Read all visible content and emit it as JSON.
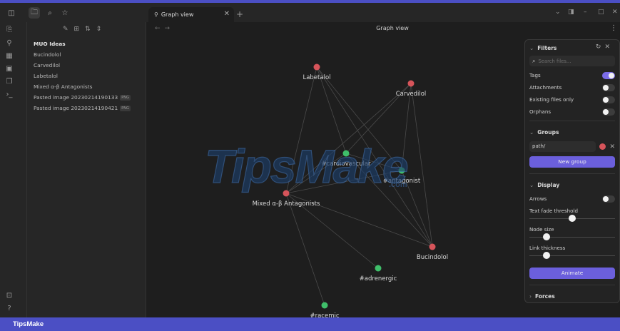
{
  "titlebar": {
    "tab_title": "Graph view",
    "tab_icon": "graph-icon",
    "win_controls": [
      "chevron-down-icon",
      "layout-icon",
      "minimize-icon",
      "maximize-icon",
      "close-icon"
    ]
  },
  "ribbon": {
    "icons": [
      "open-file-icon",
      "graph-icon",
      "canvas-icon",
      "calendar-icon",
      "copy-icon",
      "terminal-icon"
    ],
    "bottom_icons": [
      "vault-icon",
      "help-icon"
    ]
  },
  "sidebar": {
    "tools": [
      "new-note-icon",
      "new-folder-icon",
      "sort-icon",
      "collapse-icon"
    ],
    "folder": "MUO Ideas",
    "files": [
      {
        "name": "Bucindolol",
        "badge": ""
      },
      {
        "name": "Carvedilol",
        "badge": ""
      },
      {
        "name": "Labetalol",
        "badge": ""
      },
      {
        "name": "Mixed α-β Antagonists",
        "badge": ""
      },
      {
        "name": "Pasted image 20230214190133",
        "badge": "PNG"
      },
      {
        "name": "Pasted image 20230214190421",
        "badge": "PNG"
      }
    ]
  },
  "main": {
    "title": "Graph view"
  },
  "graph": {
    "nodes": [
      {
        "label": "Labetalol",
        "kind": "note",
        "color": "#d6545a"
      },
      {
        "label": "Carvedilol",
        "kind": "note",
        "color": "#d6545a"
      },
      {
        "label": "#cardiovascular",
        "kind": "tag",
        "color": "#3fbf6a"
      },
      {
        "label": "#antagonist",
        "kind": "tag",
        "color": "#3fbf6a"
      },
      {
        "label": "Mixed α-β Antagonists",
        "kind": "note",
        "color": "#d6545a"
      },
      {
        "label": "Bucindolol",
        "kind": "note",
        "color": "#d6545a"
      },
      {
        "label": "#adrenergic",
        "kind": "tag",
        "color": "#3fbf6a"
      },
      {
        "label": "#racemic",
        "kind": "tag",
        "color": "#3fbf6a"
      }
    ]
  },
  "watermark": {
    "text": "TipsMake",
    "suffix": ".com"
  },
  "filters": {
    "title": "Filters",
    "search_placeholder": "Search files...",
    "toggles": [
      {
        "label": "Tags",
        "on": true
      },
      {
        "label": "Attachments",
        "on": false
      },
      {
        "label": "Existing files only",
        "on": false
      },
      {
        "label": "Orphans",
        "on": false
      }
    ],
    "groups_title": "Groups",
    "group_query": "path/",
    "group_color": "#d6545a",
    "new_group_label": "New group",
    "display_title": "Display",
    "arrows_label": "Arrows",
    "arrows_on": false,
    "sliders": [
      {
        "label": "Text fade threshold",
        "value": 0.5
      },
      {
        "label": "Node size",
        "value": 0.2
      },
      {
        "label": "Link thickness",
        "value": 0.2
      }
    ],
    "animate_label": "Animate",
    "forces_title": "Forces"
  },
  "statusbar": {
    "text": "TipsMake"
  },
  "colors": {
    "accent": "#6b5fdc",
    "bottom_bar": "#4b4fc4",
    "note_node": "#d6545a",
    "tag_node": "#3fbf6a"
  }
}
